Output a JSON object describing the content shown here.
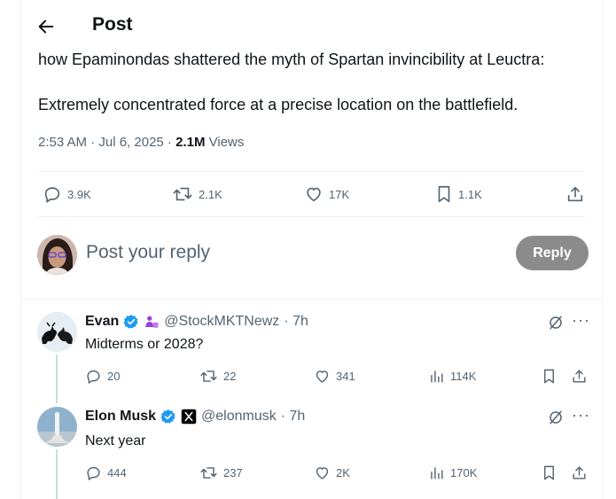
{
  "header": {
    "title": "Post"
  },
  "tweet": {
    "line1": "how Epaminondas shattered the myth of Spartan invincibility at Leuctra:",
    "line2": "Extremely concentrated force at a precise location on the battlefield.",
    "time": "2:53 AM · Jul 6, 2025 ·",
    "views_count": "2.1M",
    "views_label": "Views",
    "replies": "3.9K",
    "reposts": "2.1K",
    "likes": "17K",
    "bookmarks": "1.1K"
  },
  "compose": {
    "placeholder": "Post your reply",
    "button": "Reply"
  },
  "replies": [
    {
      "name": "Evan",
      "handle": "@StockMKTNewz",
      "time": "· 7h",
      "text": "Midterms or 2028?",
      "replies": "20",
      "reposts": "22",
      "likes": "341",
      "views": "114K"
    },
    {
      "name": "Elon Musk",
      "handle": "@elonmusk",
      "time": "· 7h",
      "text": "Next year",
      "replies": "444",
      "reposts": "237",
      "likes": "2K",
      "views": "170K"
    }
  ],
  "icons": {
    "back": "arrow-left-icon",
    "reply": "speech-bubble-icon",
    "repost": "repost-arrows-icon",
    "like": "heart-icon",
    "bookmark": "bookmark-icon",
    "share": "share-upload-icon",
    "views": "bar-chart-icon",
    "verified": "verified-badge-icon",
    "grok": "grok-icon",
    "more": "more-dots-icon"
  },
  "colors": {
    "verified": "#1d9bf0",
    "reply_button": "#8b8b8b",
    "muted_text": "#536471",
    "affiliate_badge": "#9b3fd4"
  }
}
